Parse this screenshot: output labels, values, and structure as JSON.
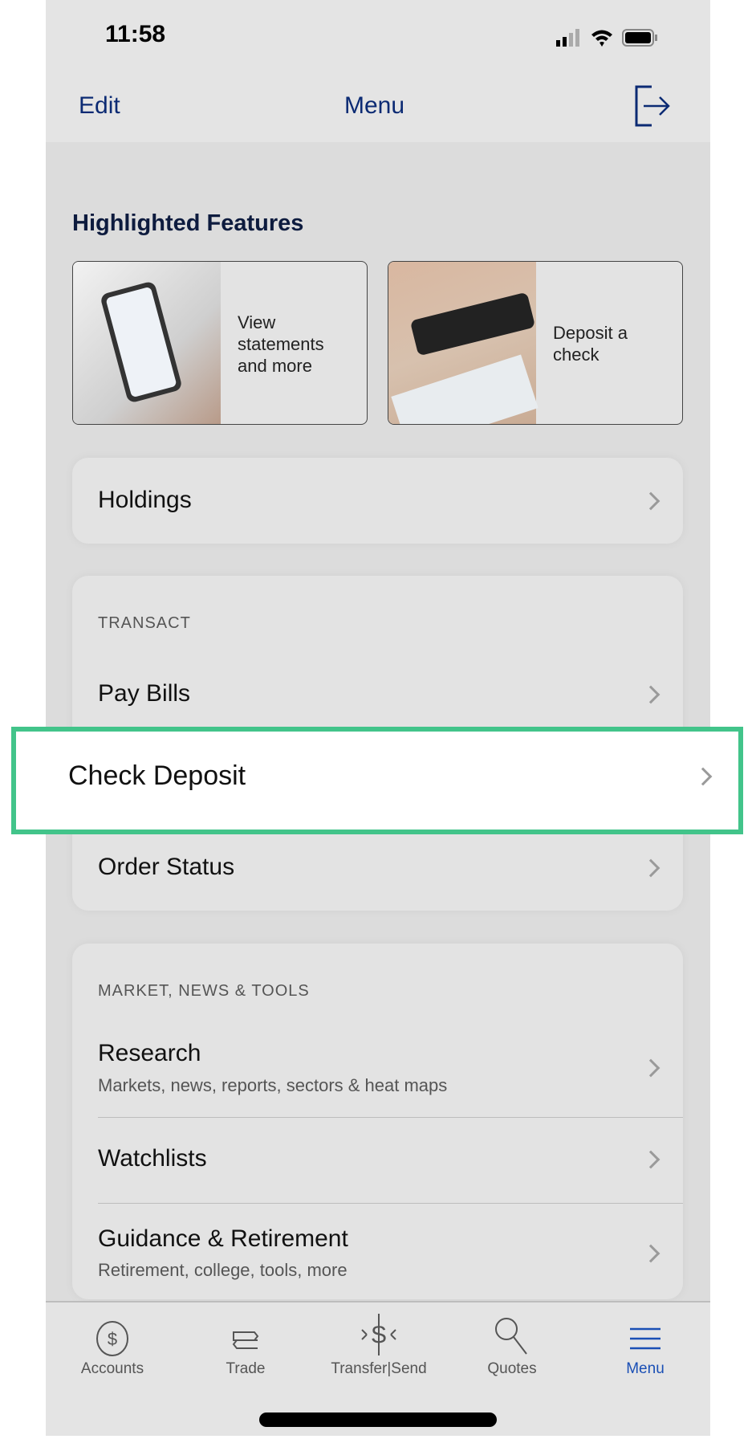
{
  "status_bar": {
    "time": "11:58"
  },
  "nav": {
    "edit": "Edit",
    "title": "Menu",
    "logout_icon": "logout-icon"
  },
  "highlighted": {
    "title": "Highlighted Features",
    "cards": [
      {
        "text": "View statements and more"
      },
      {
        "text": "Deposit a check"
      }
    ]
  },
  "holdings": {
    "label": "Holdings"
  },
  "transact": {
    "section": "TRANSACT",
    "items": [
      {
        "label": "Pay Bills"
      },
      {
        "label": "Check Deposit"
      },
      {
        "label": "Order Status"
      }
    ]
  },
  "market": {
    "section": "MARKET, NEWS & TOOLS",
    "items": [
      {
        "label": "Research",
        "sub": "Markets, news, reports, sectors & heat maps"
      },
      {
        "label": "Watchlists"
      },
      {
        "label": "Guidance & Retirement",
        "sub": "Retirement, college, tools, more"
      }
    ]
  },
  "tabs": [
    {
      "label": "Accounts",
      "icon": "dollar-circle-icon"
    },
    {
      "label": "Trade",
      "icon": "trade-icon"
    },
    {
      "label": "Transfer|Send",
      "icon": "transfer-icon"
    },
    {
      "label": "Quotes",
      "icon": "search-icon"
    },
    {
      "label": "Menu",
      "icon": "menu-icon",
      "active": true
    }
  ],
  "colors": {
    "nav_text": "#0b2a73",
    "active_tab": "#1a4fb5",
    "highlight": "#42c48a"
  }
}
